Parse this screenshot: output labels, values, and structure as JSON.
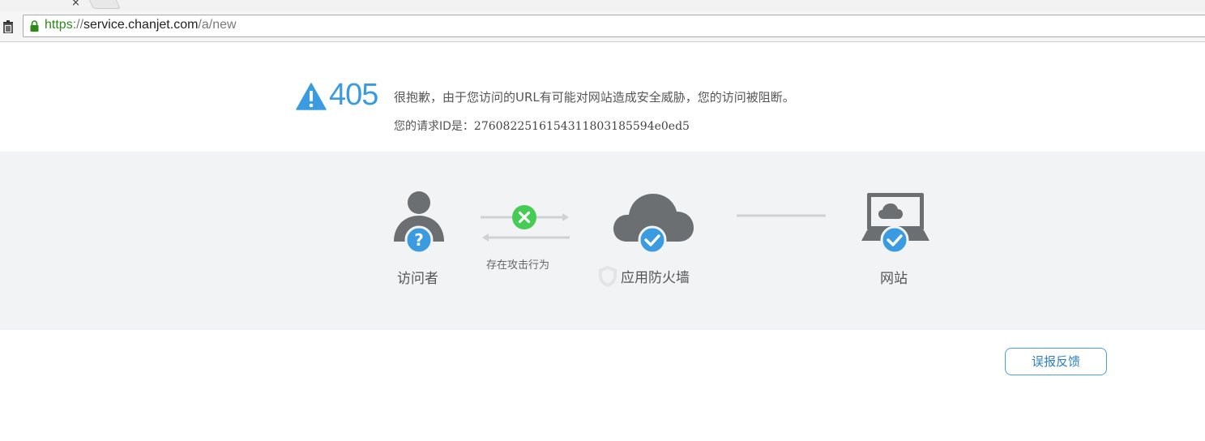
{
  "browser": {
    "tab_close_glyph": "×",
    "url": {
      "scheme": "https",
      "separator": "://",
      "host": "service.chanjet.com",
      "path": "/a/new"
    }
  },
  "error": {
    "code": "405",
    "message": "很抱歉，由于您访问的URL有可能对网站造成安全威胁，您的访问被阻断。",
    "request_id_label": "您的请求ID是：",
    "request_id": "2760822516154311803185594e0ed5"
  },
  "diagram": {
    "visitor_label": "访问者",
    "attack_label": "存在攻击行为",
    "firewall_label": "应用防火墙",
    "website_label": "网站",
    "icons": {
      "visitor": "person-question-icon",
      "blocked": "x-circle-icon",
      "firewall": "cloud-check-icon",
      "shield": "shield-icon",
      "website": "laptop-check-icon"
    },
    "colors": {
      "accent_blue": "#3a9be0",
      "block_green": "#44cc55",
      "icon_gray": "#6b6f72",
      "band_bg": "#f2f3f4"
    }
  },
  "actions": {
    "report_label": "误报反馈"
  }
}
